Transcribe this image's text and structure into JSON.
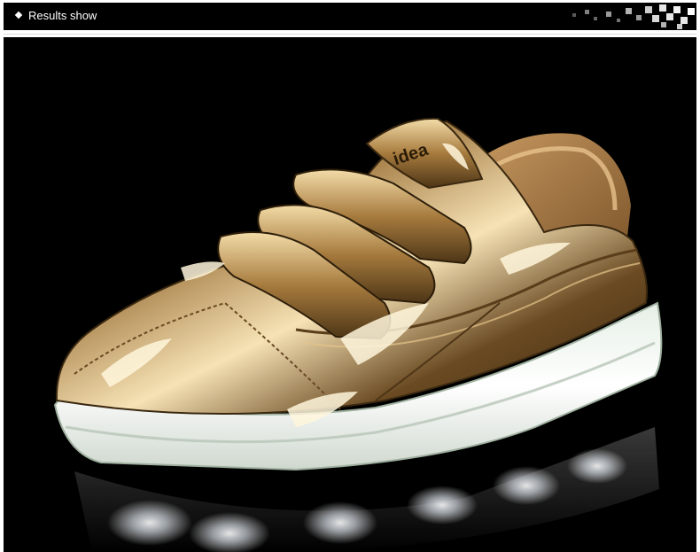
{
  "header": {
    "title": "Results show",
    "bullet_icon": "diamond-bullet-icon",
    "decoration": "pixel-mosaic-decoration"
  },
  "photo": {
    "subject": "gold metallic light-up sneaker with hook-and-loop straps",
    "tongue_logo_text": "idea",
    "colors": {
      "background": "#000000",
      "upper_gold": "#b48a4a",
      "highlight": "#fff4d6",
      "sole_glow": "#f2f7f0"
    }
  }
}
